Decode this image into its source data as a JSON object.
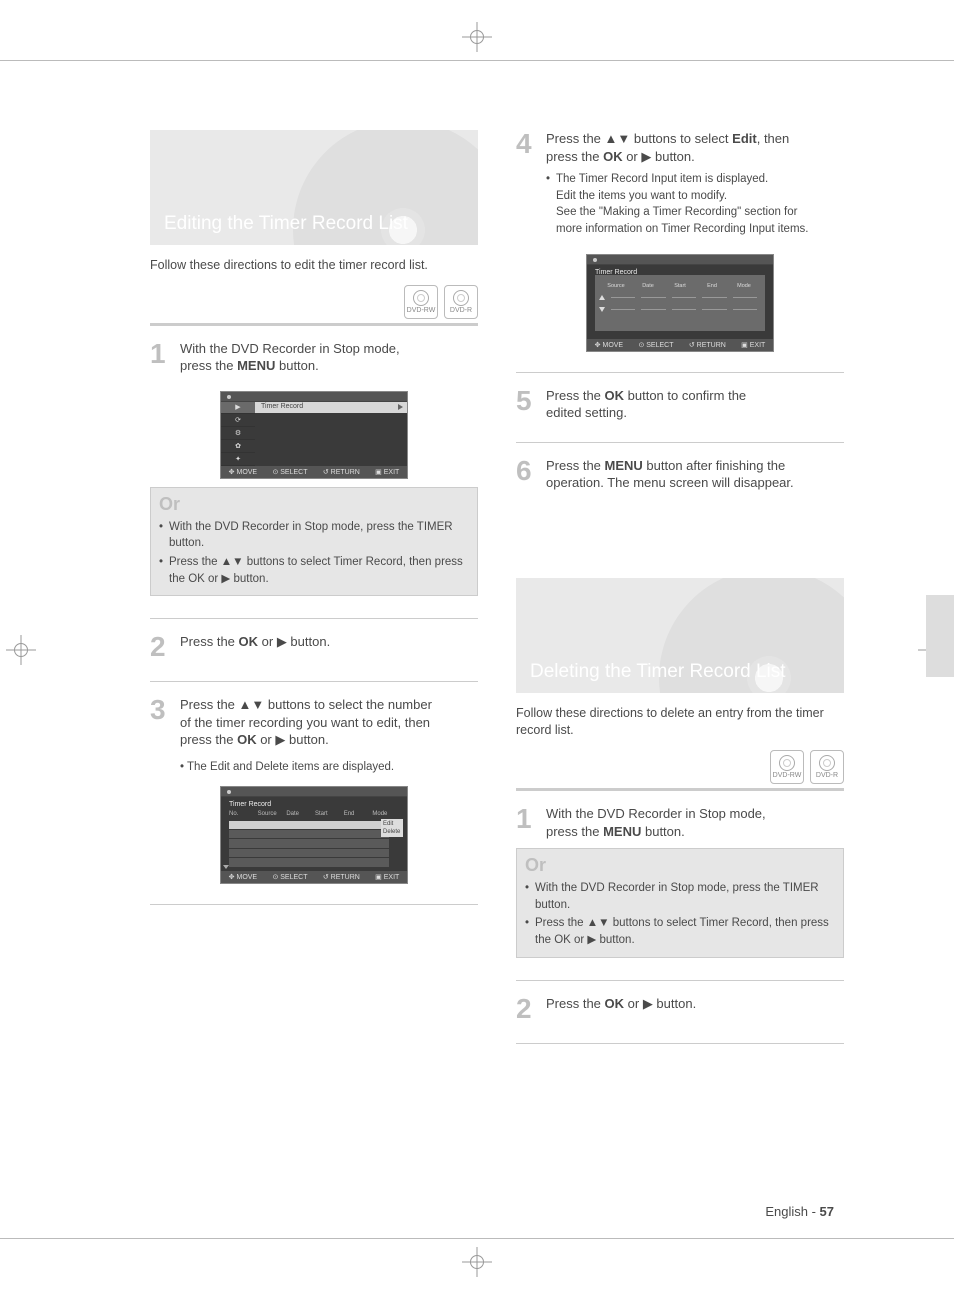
{
  "section_edit": {
    "hero_title": "Editing the Timer Record List",
    "lead": "Follow these directions to edit the timer record list.",
    "badges": [
      "DVD-RW",
      "DVD-R"
    ],
    "step1": {
      "num": "1",
      "line1_a": "With the DVD Recorder in Stop mode,",
      "line2_a": "press the ",
      "line2_btn": "MENU",
      "line2_b": " button."
    },
    "thumb_menu": {
      "side": [
        "▶",
        "⟳",
        "⚙",
        "✿",
        "✦"
      ],
      "panel_label": "Timer Record",
      "foot": [
        "MOVE",
        "SELECT",
        "RETURN",
        "EXIT"
      ]
    },
    "or": {
      "label": "Or",
      "b1_a": "With the DVD Recorder in Stop mode, press the ",
      "b1_btn": "TIMER",
      "b1_b": " button.",
      "b2_a": "Press the ▲▼ buttons to select ",
      "b2_sel": "Timer Record",
      "b2_b": ", then press the ",
      "b2_ok": "OK",
      "b2_c": " or  ▶ button."
    },
    "step2": {
      "num": "2",
      "a": "Press the ",
      "ok": "OK",
      "b": " or ▶ button."
    },
    "step3": {
      "num": "3",
      "l1": "Press the ▲▼ buttons to select the number",
      "l2": "of the timer recording you want to edit, then",
      "l3a": "press the ",
      "l3ok": "OK",
      "l3b": " or ▶ button.",
      "sub": "• The Edit and Delete items are displayed."
    },
    "thumb_list": {
      "title": "Timer Record",
      "heads": [
        "No.",
        "Source",
        "Date",
        "Start",
        "End",
        "Mode"
      ],
      "popup": [
        "Edit",
        "Delete"
      ],
      "foot": [
        "MOVE",
        "SELECT",
        "RETURN",
        "EXIT"
      ]
    },
    "step4": {
      "num": "4",
      "l1a": "Press the ▲▼ buttons to select ",
      "l1sel": "Edit",
      "l1b": ", then",
      "l2a": "press the ",
      "l2ok": "OK",
      "l2b": " or ▶ button.",
      "sub1": "The Timer Record Input item is displayed.",
      "sub2": "Edit the items you want to modify.",
      "sub3": "See the \"Making a Timer Recording\" section for",
      "sub4": "more information on Timer Recording Input items."
    },
    "thumb_input": {
      "title": "Timer Record",
      "heads": [
        "Source",
        "Date",
        "Start",
        "End",
        "Mode"
      ],
      "foot": [
        "MOVE",
        "SELECT",
        "RETURN",
        "EXIT"
      ]
    },
    "step5": {
      "num": "5",
      "a": "Press the ",
      "ok": "OK",
      "b": " button to confirm the",
      "c": "edited setting."
    },
    "step6": {
      "num": "6",
      "a": "Press the ",
      "btn": "MENU",
      "b": " button after finishing the",
      "c": "operation. The menu screen will disappear."
    }
  },
  "section_delete": {
    "hero_title": "Deleting the Timer Record List",
    "lead": "Follow these directions to delete an entry from the timer record list.",
    "badges": [
      "DVD-RW",
      "DVD-R"
    ],
    "step1": {
      "num": "1",
      "line1_a": "With the DVD Recorder in Stop mode,",
      "line2_a": "press the ",
      "line2_btn": "MENU",
      "line2_b": " button."
    },
    "or": {
      "label": "Or",
      "b1_a": "With the DVD Recorder in Stop mode, press the ",
      "b1_btn": "TIMER",
      "b1_b": " button.",
      "b2_a": "Press the ▲▼ buttons to select ",
      "b2_sel": "Timer Record",
      "b2_b": ", then press the ",
      "b2_ok": "OK",
      "b2_c": " or  ▶ button."
    },
    "step2": {
      "num": "2",
      "a": "Press the ",
      "ok": "OK",
      "b": " or ▶ button."
    }
  },
  "footer": {
    "lang": "English -",
    "page": "57"
  }
}
